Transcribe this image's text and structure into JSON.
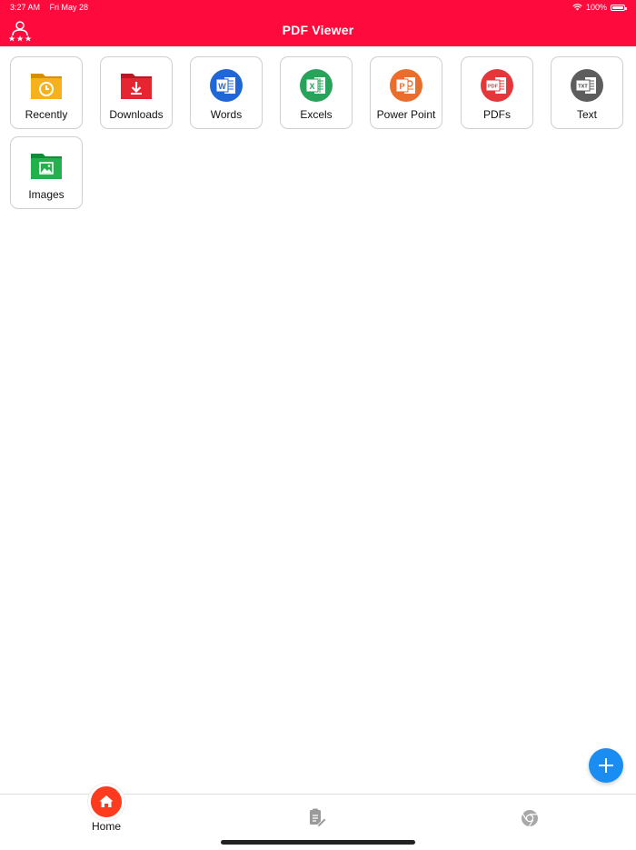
{
  "status_bar": {
    "time": "3:27 AM",
    "date": "Fri May 28",
    "battery": "100%"
  },
  "header": {
    "title": "PDF Viewer",
    "profile_icon": "user-rating-icon"
  },
  "categories": [
    {
      "label": "Recently",
      "icon": "clock-folder-icon",
      "color": "#f0a80f"
    },
    {
      "label": "Downloads",
      "icon": "download-folder-icon",
      "color": "#e5252f"
    },
    {
      "label": "Words",
      "icon": "word-doc-icon",
      "color": "#1f66d6"
    },
    {
      "label": "Excels",
      "icon": "excel-doc-icon",
      "color": "#2aa35a"
    },
    {
      "label": "Power Point",
      "icon": "powerpoint-doc-icon",
      "color": "#ea6d2c"
    },
    {
      "label": "PDFs",
      "icon": "pdf-doc-icon",
      "color": "#e5363a"
    },
    {
      "label": "Text",
      "icon": "txt-doc-icon",
      "color": "#5d5d5d"
    },
    {
      "label": "Images",
      "icon": "image-folder-icon",
      "color": "#22b14c"
    }
  ],
  "fab": {
    "icon": "plus-icon",
    "color": "#1a8df2"
  },
  "tabbar": {
    "home_label": "Home",
    "home_icon": "home-icon",
    "edit_icon": "document-edit-icon",
    "browser_icon": "chrome-icon"
  },
  "colors": {
    "header": "#ff0a3c",
    "home_active": "#ff3b1f"
  }
}
